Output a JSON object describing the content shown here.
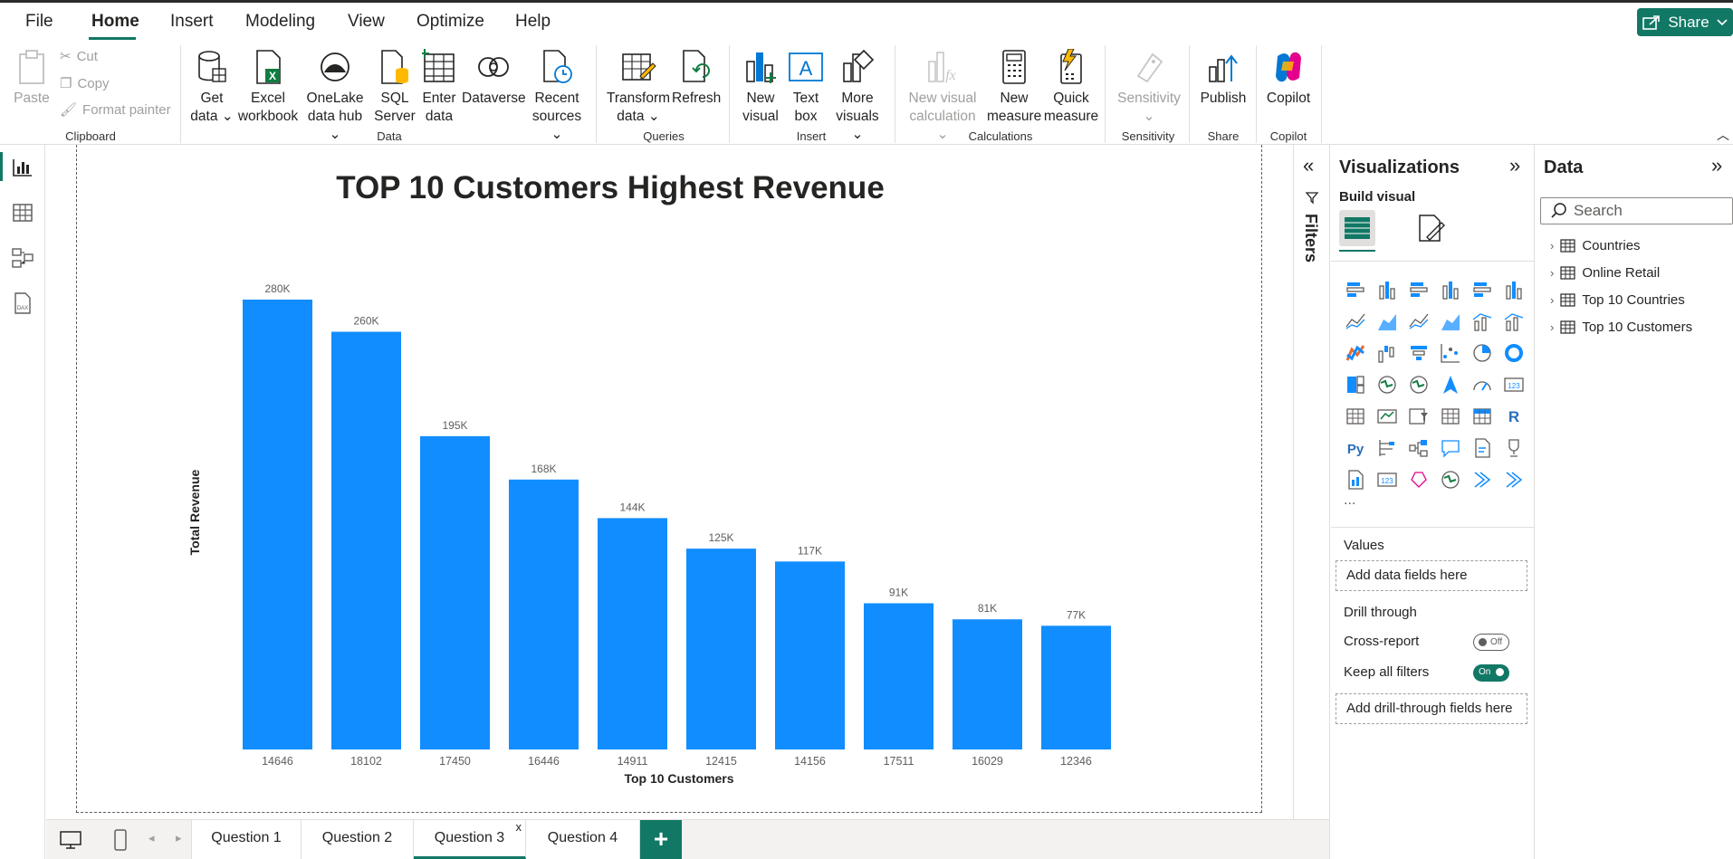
{
  "menu": {
    "file": "File",
    "home": "Home",
    "insert": "Insert",
    "modeling": "Modeling",
    "view": "View",
    "optimize": "Optimize",
    "help": "Help",
    "share": "Share"
  },
  "ribbon": {
    "clipboard": {
      "paste": "Paste",
      "cut": "Cut",
      "copy": "Copy",
      "format_painter": "Format painter",
      "label": "Clipboard"
    },
    "data": {
      "get_data": [
        "Get",
        "data"
      ],
      "excel": [
        "Excel",
        "workbook"
      ],
      "onelake": [
        "OneLake",
        "data hub"
      ],
      "sql": [
        "SQL",
        "Server"
      ],
      "enter": [
        "Enter",
        "data"
      ],
      "dataverse": "Dataverse",
      "recent": [
        "Recent",
        "sources"
      ],
      "label": "Data"
    },
    "queries": {
      "transform": [
        "Transform",
        "data"
      ],
      "refresh": "Refresh",
      "label": "Queries"
    },
    "insert": {
      "new_visual": [
        "New",
        "visual"
      ],
      "text_box": [
        "Text",
        "box"
      ],
      "more_visuals": [
        "More",
        "visuals"
      ],
      "label": "Insert"
    },
    "calculations": {
      "new_visual_calc": [
        "New visual",
        "calculation"
      ],
      "new_measure": [
        "New",
        "measure"
      ],
      "quick_measure": [
        "Quick",
        "measure"
      ],
      "label": "Calculations"
    },
    "sensitivity": {
      "btn": "Sensitivity",
      "label": "Sensitivity"
    },
    "share": {
      "publish": "Publish",
      "label": "Share"
    },
    "copilot": {
      "btn": "Copilot",
      "label": "Copilot"
    }
  },
  "chart_data": {
    "type": "bar",
    "title": "TOP 10 Customers Highest Revenue",
    "xlabel": "Top 10 Customers",
    "ylabel": "Total Revenue",
    "categories": [
      "14646",
      "18102",
      "17450",
      "16446",
      "14911",
      "12415",
      "14156",
      "17511",
      "16029",
      "12346"
    ],
    "values": [
      280,
      260,
      195,
      168,
      144,
      125,
      117,
      91,
      81,
      77
    ],
    "data_labels": [
      "280K",
      "260K",
      "195K",
      "168K",
      "144K",
      "125K",
      "117K",
      "91K",
      "81K",
      "77K"
    ],
    "ylim": [
      0,
      280
    ],
    "grid": false,
    "bar_color": "#118DFF"
  },
  "filters": {
    "label": "Filters"
  },
  "visualizations": {
    "title": "Visualizations",
    "build_visual": "Build visual",
    "values_label": "Values",
    "values_placeholder": "Add data fields here",
    "drill_through": "Drill through",
    "cross_report": "Cross-report",
    "cross_report_state": "Off",
    "keep_filters": "Keep all filters",
    "keep_filters_state": "On",
    "drill_placeholder": "Add drill-through fields here",
    "more": "..."
  },
  "data_pane": {
    "title": "Data",
    "search_placeholder": "Search",
    "tables": [
      "Countries",
      "Online Retail",
      "Top 10 Countries",
      "Top 10 Customers"
    ]
  },
  "pages": {
    "tabs": [
      "Question 1",
      "Question 2",
      "Question 3",
      "Question 4"
    ],
    "active": "Question 3",
    "close": "x",
    "add": "+"
  },
  "colors": {
    "accent": "#117865",
    "bar": "#118DFF"
  }
}
